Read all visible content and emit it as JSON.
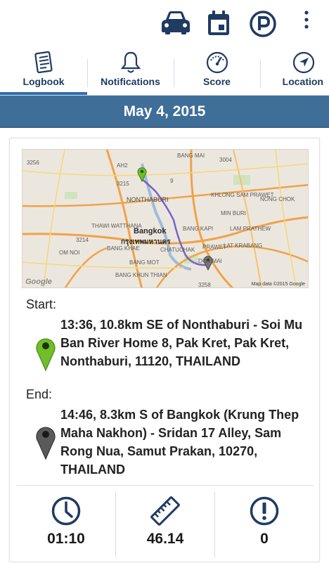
{
  "action_bar": {
    "icons": [
      "car-icon",
      "calendar-icon",
      "parking-icon",
      "more-vert-icon"
    ],
    "accent_color": "#1f3b62"
  },
  "tabs": [
    {
      "label": "Logbook",
      "icon": "logbook-icon",
      "selected": true
    },
    {
      "label": "Notifications",
      "icon": "bell-icon",
      "selected": false
    },
    {
      "label": "Score",
      "icon": "speedometer-icon",
      "selected": false
    },
    {
      "label": "Location",
      "icon": "navigation-arrow-icon",
      "selected": false
    }
  ],
  "date_header": "May 4, 2015",
  "map": {
    "labels": {
      "nonthaburi": "NONTHABURI",
      "bangkok": "Bangkok",
      "bangkok_thai": "กรุงเทพมหานคร",
      "bang_mai": "BANG MAI",
      "khlong_sam_prawet": "KHLONG SAM PRAWET",
      "nong_chok": "NONG CHOK",
      "min_buri": "MIN BURI",
      "lam_prathew": "LAM PRATHEW",
      "lat_krabang": "LAT KRABANG",
      "bang_kapi": "BANG KAPI",
      "prawet": "PRAWET",
      "dok_mai": "DOK MAI",
      "thawi_watthana": "THAWI WATTHANA",
      "bang_khae": "BANG KHAE",
      "bang_mot": "BANG MOT",
      "bang_khun_thian": "BANG KHUN THIAN",
      "om_noi": "OM NOI",
      "chatuchak": "CHATUCHAK",
      "road_3256": "3256",
      "road_3215": "3215",
      "road_3004": "3004",
      "road_3214": "3214",
      "road_3258": "3258",
      "road_9": "9",
      "road_ah2": "AH2"
    },
    "attribution": "Map data ©2015 Google",
    "logo": "Google"
  },
  "start": {
    "label": "Start:",
    "text": "13:36, 10.8km SE of Nonthaburi - Soi Mu Ban River Home 8, Pak Kret, Pak Kret, Nonthaburi, 11120, THAILAND",
    "pin_color": "#6fbe2a"
  },
  "end": {
    "label": "End:",
    "text": "14:46, 8.3km S of Bangkok (Krung Thep Maha Nakhon) - Sridan 17 Alley, Sam Rong Nua, Samut Prakan, 10270, THAILAND",
    "pin_color": "#555555"
  },
  "stats": [
    {
      "icon": "clock-icon",
      "value": "01:10"
    },
    {
      "icon": "ruler-icon",
      "value": "46.14"
    },
    {
      "icon": "alert-icon",
      "value": "0"
    }
  ]
}
